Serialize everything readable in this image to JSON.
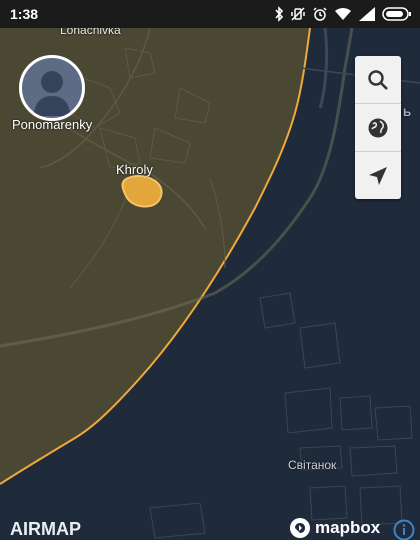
{
  "status_bar": {
    "time": "1:38",
    "icons": [
      "bluetooth-icon",
      "vibrate-icon",
      "alarm-icon",
      "wifi-icon",
      "signal-icon",
      "battery-icon"
    ]
  },
  "map": {
    "places": {
      "lonachivka": "Lonachivka",
      "ponomarenky": "Ponomarenky",
      "khroly": "Khroly",
      "rogan": "РОГАНЬ",
      "svitanok": "Світанок"
    },
    "colors": {
      "restricted_zone": "#4a4833",
      "zone_border": "#f0a93a",
      "water_dark": "#1f2b3b",
      "marker_fill": "#e2a63a"
    }
  },
  "controls": {
    "search_icon": "search-icon",
    "globe_icon": "globe-icon",
    "locate_icon": "navigation-arrow-icon"
  },
  "profile": {
    "avatar_icon": "user-avatar-icon"
  },
  "footer": {
    "brand": "AIRMAP",
    "attribution": "mapbox",
    "info_icon": "info-icon"
  }
}
